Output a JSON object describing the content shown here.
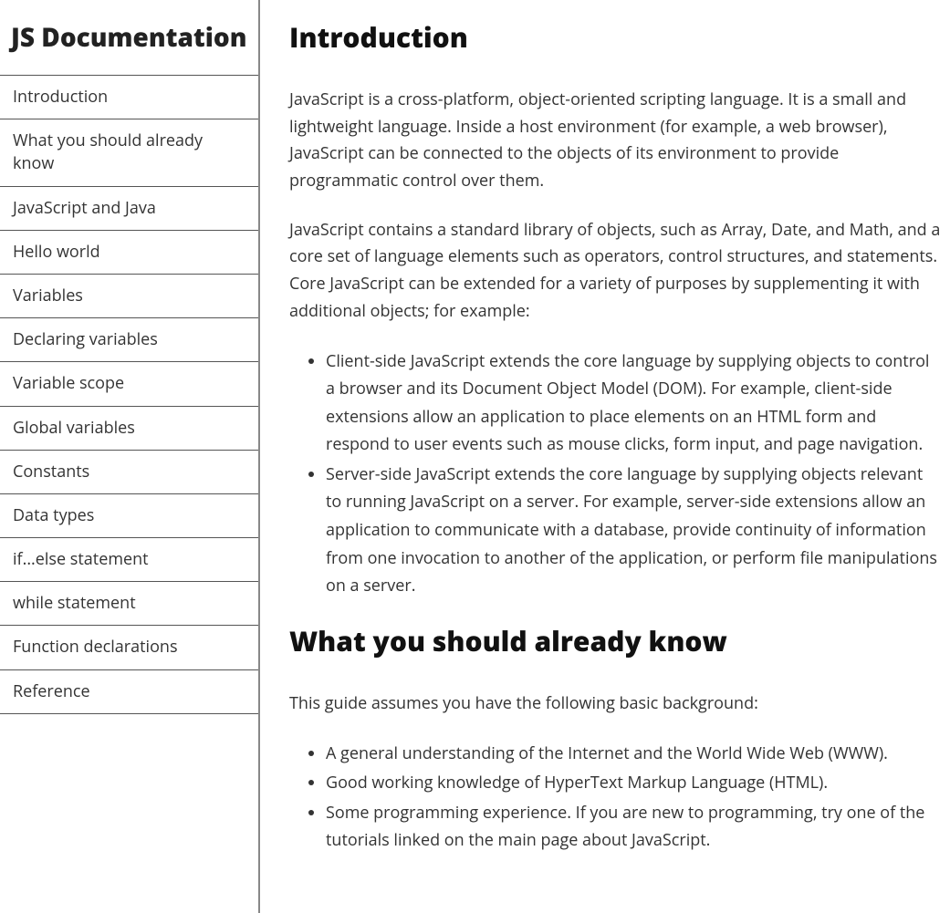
{
  "sidebar": {
    "title": "JS Documentation",
    "items": [
      {
        "label": "Introduction"
      },
      {
        "label": "What you should already know"
      },
      {
        "label": "JavaScript and Java"
      },
      {
        "label": "Hello world"
      },
      {
        "label": "Variables"
      },
      {
        "label": "Declaring variables"
      },
      {
        "label": "Variable scope"
      },
      {
        "label": "Global variables"
      },
      {
        "label": "Constants"
      },
      {
        "label": "Data types"
      },
      {
        "label": "if...else statement"
      },
      {
        "label": "while statement"
      },
      {
        "label": "Function declarations"
      },
      {
        "label": "Reference"
      }
    ]
  },
  "sections": {
    "introduction": {
      "heading": "Introduction",
      "p1": "JavaScript is a cross-platform, object-oriented scripting language. It is a small and lightweight language. Inside a host environment (for example, a web browser), JavaScript can be connected to the objects of its environment to provide programmatic control over them.",
      "p2": "JavaScript contains a standard library of objects, such as Array, Date, and Math, and a core set of language elements such as operators, control structures, and statements. Core JavaScript can be extended for a variety of purposes by supplementing it with additional objects; for example:",
      "li1": "Client-side JavaScript extends the core language by supplying objects to control a browser and its Document Object Model (DOM). For example, client-side extensions allow an application to place elements on an HTML form and respond to user events such as mouse clicks, form input, and page navigation.",
      "li2": "Server-side JavaScript extends the core language by supplying objects relevant to running JavaScript on a server. For example, server-side extensions allow an application to communicate with a database, provide continuity of information from one invocation to another of the application, or perform file manipulations on a server."
    },
    "already_know": {
      "heading": "What you should already know",
      "p1": "This guide assumes you have the following basic background:",
      "li1": "A general understanding of the Internet and the World Wide Web (WWW).",
      "li2": "Good working knowledge of HyperText Markup Language (HTML).",
      "li3": "Some programming experience. If you are new to programming, try one of the tutorials linked on the main page about JavaScript."
    }
  }
}
